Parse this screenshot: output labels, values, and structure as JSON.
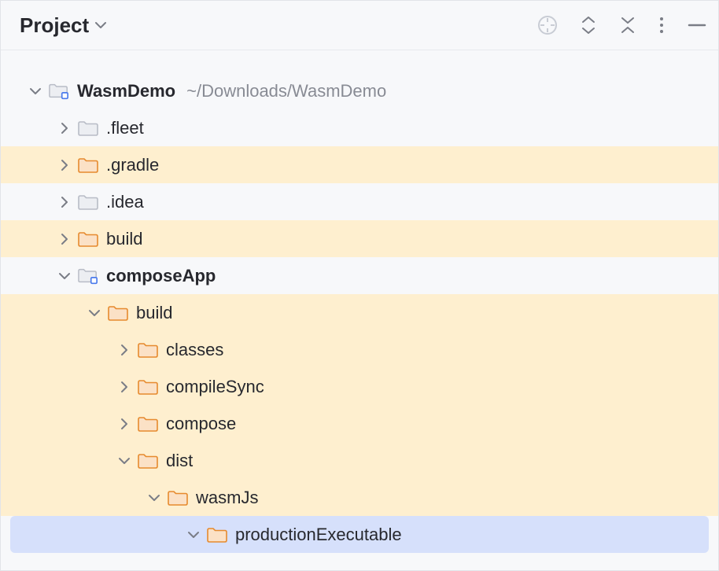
{
  "header": {
    "title": "Project"
  },
  "tree": {
    "root": {
      "label": "WasmDemo",
      "path": "~/Downloads/WasmDemo"
    },
    "fleet": {
      "label": ".fleet"
    },
    "gradle": {
      "label": ".gradle"
    },
    "idea": {
      "label": ".idea"
    },
    "build0": {
      "label": "build"
    },
    "composeApp": {
      "label": "composeApp"
    },
    "build1": {
      "label": "build"
    },
    "classes": {
      "label": "classes"
    },
    "compileSync": {
      "label": "compileSync"
    },
    "compose": {
      "label": "compose"
    },
    "dist": {
      "label": "dist"
    },
    "wasmJs": {
      "label": "wasmJs"
    },
    "prodExec": {
      "label": "productionExecutable"
    }
  }
}
